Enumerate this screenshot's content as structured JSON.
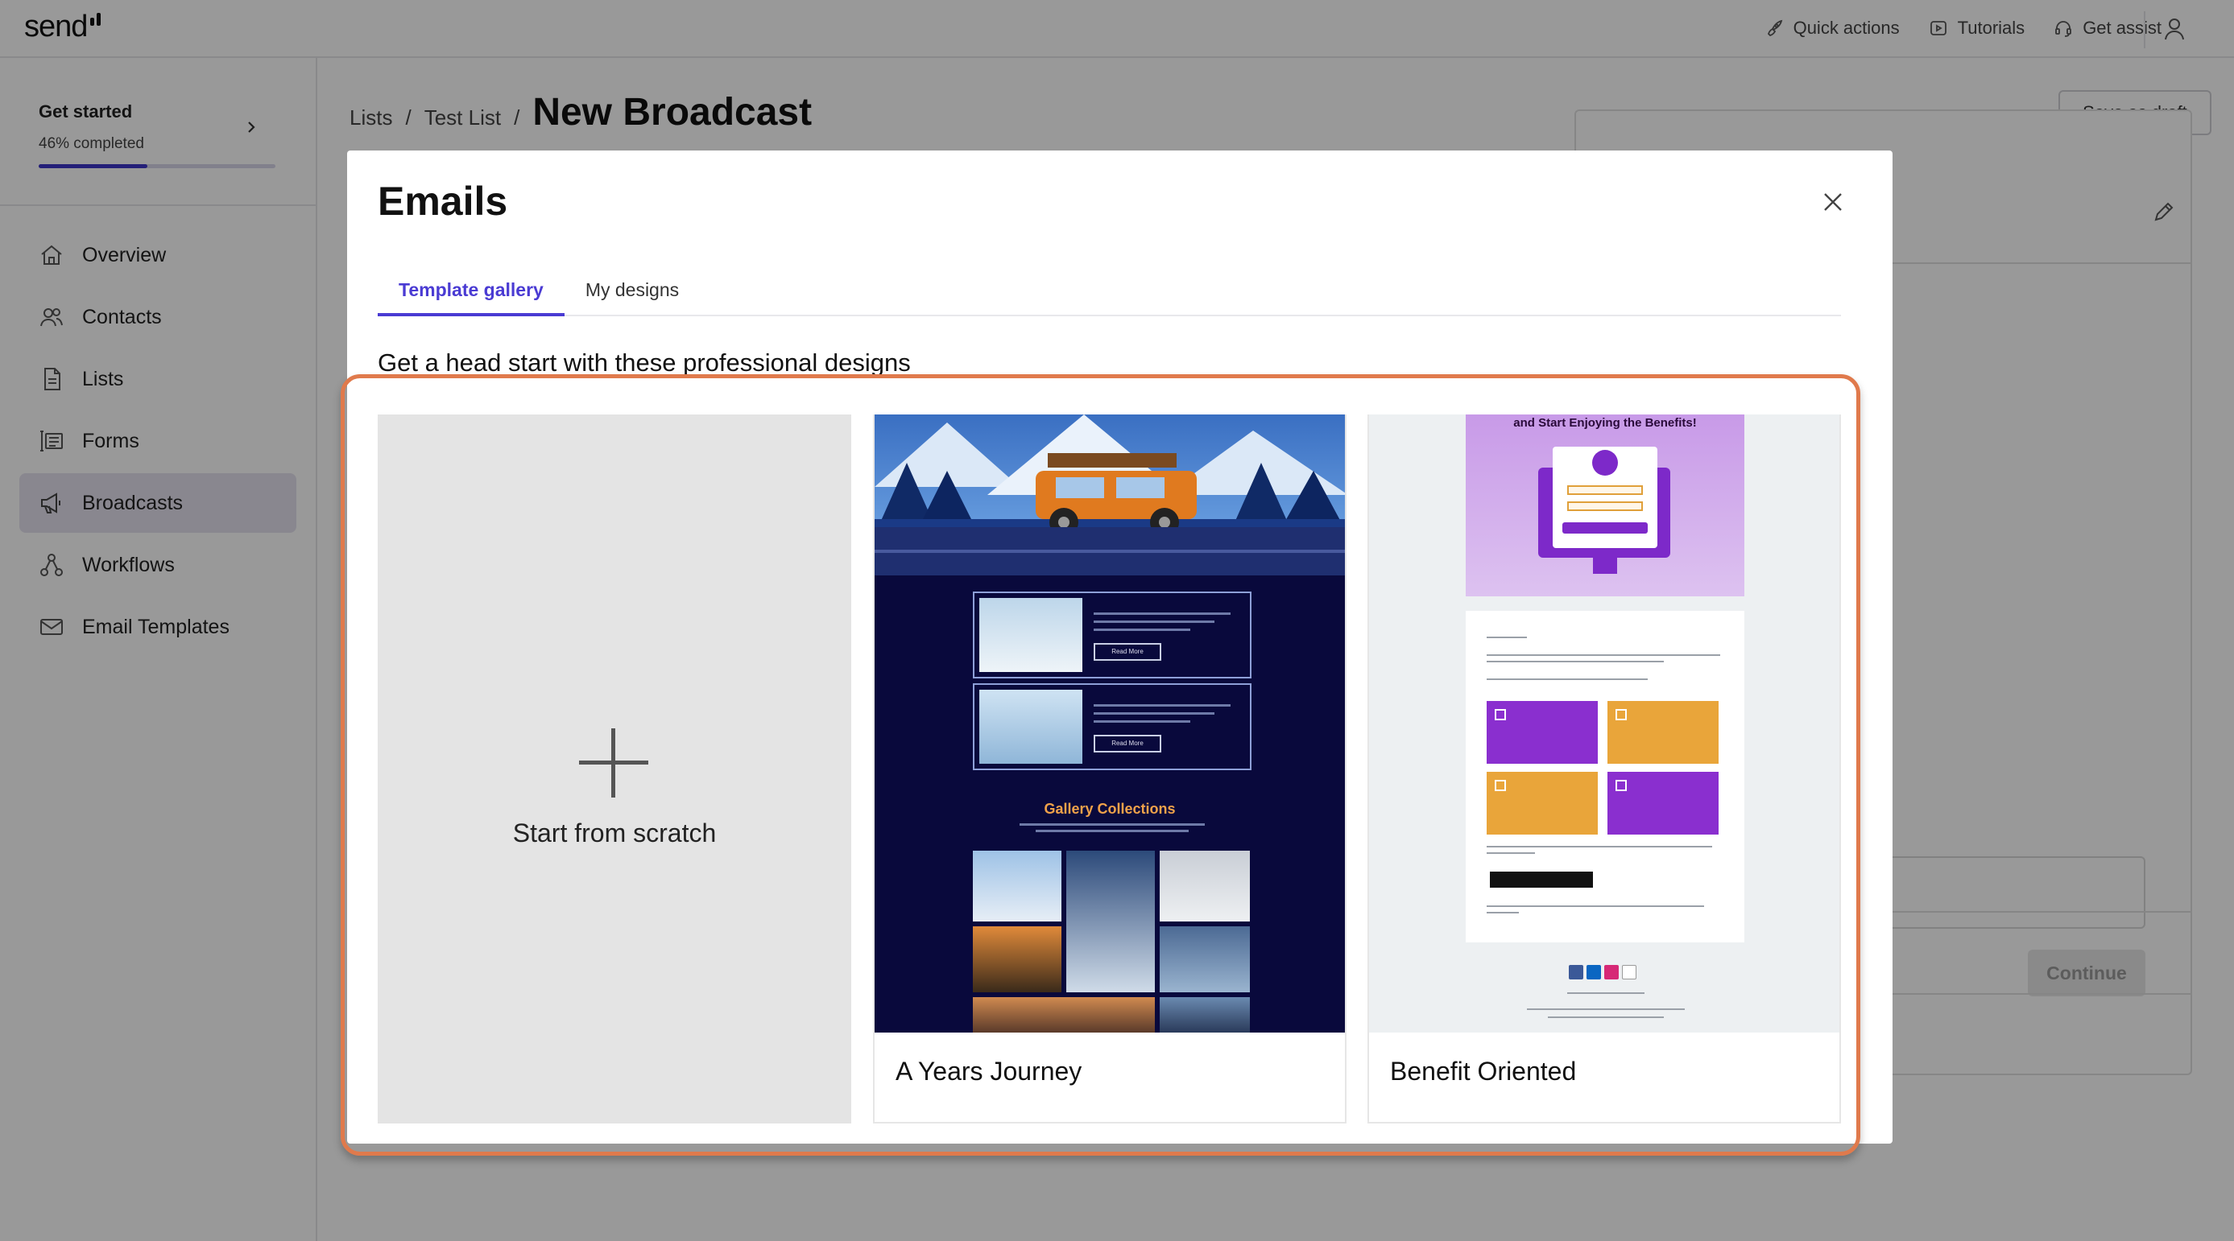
{
  "app": {
    "logo": "send",
    "top_actions": [
      {
        "label": "Quick actions",
        "icon": "rocket-icon"
      },
      {
        "label": "Tutorials",
        "icon": "play-icon"
      },
      {
        "label": "Get assist",
        "icon": "headset-icon"
      }
    ]
  },
  "sidebar": {
    "get_started": {
      "title": "Get started",
      "progress_text": "46% completed",
      "progress": 0.46
    },
    "items": [
      {
        "label": "Overview",
        "icon": "home-icon",
        "active": false
      },
      {
        "label": "Contacts",
        "icon": "users-icon",
        "active": false
      },
      {
        "label": "Lists",
        "icon": "list-icon",
        "active": false
      },
      {
        "label": "Forms",
        "icon": "form-icon",
        "active": false
      },
      {
        "label": "Broadcasts",
        "icon": "megaphone-icon",
        "active": true
      },
      {
        "label": "Workflows",
        "icon": "workflow-icon",
        "active": false
      },
      {
        "label": "Email Templates",
        "icon": "mail-icon",
        "active": false
      }
    ]
  },
  "main": {
    "breadcrumb": {
      "items": [
        "Lists",
        "Test List"
      ],
      "separator": "/",
      "current": "New Broadcast"
    },
    "save_draft_label": "Save as draft",
    "continue_label": "Continue"
  },
  "modal": {
    "title": "Emails",
    "tabs": [
      {
        "label": "Template gallery",
        "active": true
      },
      {
        "label": "My designs",
        "active": false
      }
    ],
    "subtitle": "Get a head start with these professional designs",
    "scratch_label": "Start from scratch",
    "templates": [
      {
        "name": "A Years Journey",
        "preview_text": {
          "read_more": "Read More",
          "gallery_title": "Gallery Collections"
        }
      },
      {
        "name": "Benefit Oriented",
        "preview_text": {
          "hero_title": "and Start Enjoying the Benefits!"
        }
      }
    ]
  },
  "colors": {
    "accent": "#4a3bd3",
    "highlight": "#e07a4c",
    "overlay": "rgba(0,0,0,0.40)",
    "sidebar_active": "#e4e2ee"
  }
}
